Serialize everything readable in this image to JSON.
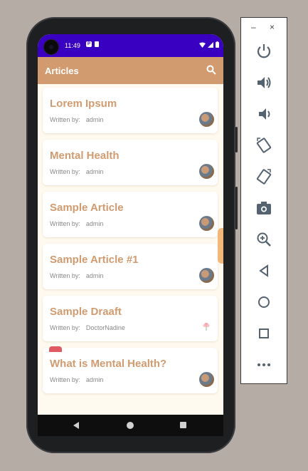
{
  "statusbar": {
    "time": "11:49"
  },
  "appbar": {
    "title": "Articles"
  },
  "articles": [
    {
      "title": "Lorem Ipsum",
      "written_by_label": "Written by:",
      "author": "admin"
    },
    {
      "title": "Mental Health",
      "written_by_label": "Written by:",
      "author": "admin"
    },
    {
      "title": "Sample Article",
      "written_by_label": "Written by:",
      "author": "admin"
    },
    {
      "title": "Sample Article #1",
      "written_by_label": "Written by:",
      "author": "admin"
    },
    {
      "title": "Sample Draaft",
      "written_by_label": "Written by:",
      "author": "DoctorNadine"
    },
    {
      "title": "What is Mental Health?",
      "written_by_label": "Written by:",
      "author": "admin"
    }
  ],
  "emulator": {
    "minimize": "–",
    "close": "×"
  },
  "colors": {
    "statusbar": "#3a00c2",
    "appbar": "#d19b6f",
    "accent_text": "#d19b6f",
    "background": "#fffaf0"
  }
}
